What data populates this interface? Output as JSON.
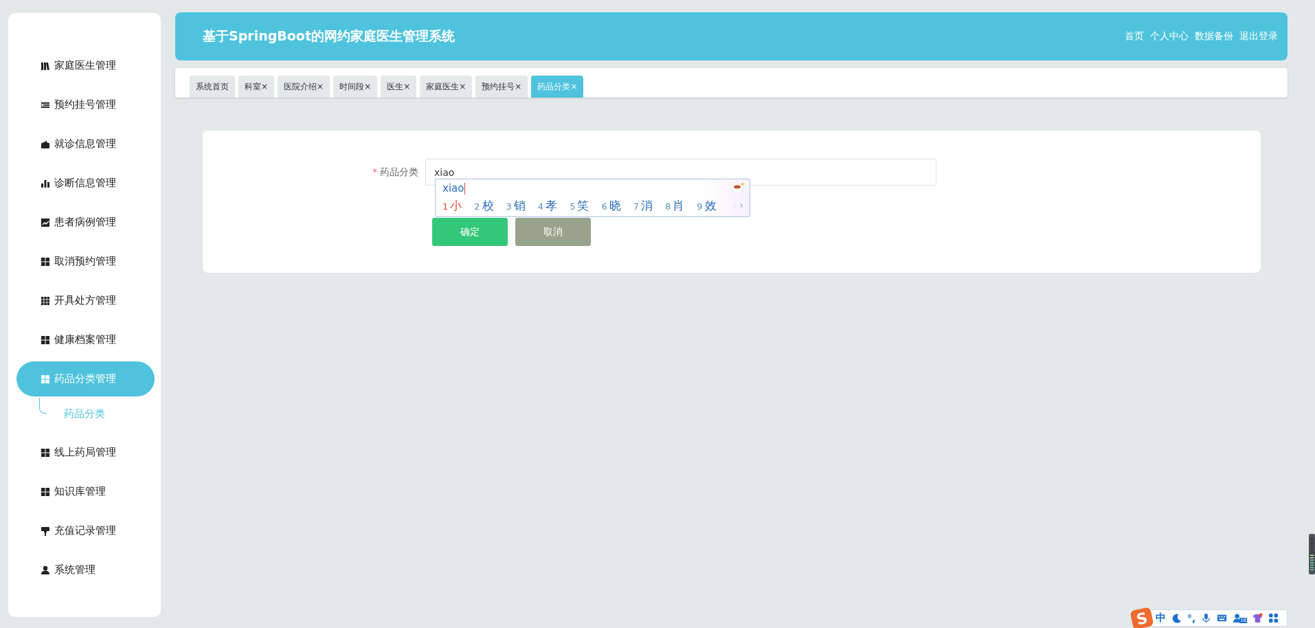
{
  "sidebar": {
    "items": [
      {
        "label": "家庭医生管理",
        "selected": false
      },
      {
        "label": "预约挂号管理",
        "selected": false
      },
      {
        "label": "就诊信息管理",
        "selected": false
      },
      {
        "label": "诊断信息管理",
        "selected": false
      },
      {
        "label": "患者病例管理",
        "selected": false
      },
      {
        "label": "取消预约管理",
        "selected": false
      },
      {
        "label": "开具处方管理",
        "selected": false
      },
      {
        "label": "健康档案管理",
        "selected": false
      },
      {
        "label": "药品分类管理",
        "selected": true,
        "children": [
          {
            "label": "药品分类",
            "selected": true
          }
        ]
      },
      {
        "label": "线上药局管理",
        "selected": false
      },
      {
        "label": "知识库管理",
        "selected": false
      },
      {
        "label": "充值记录管理",
        "selected": false
      },
      {
        "label": "系统管理",
        "selected": false
      }
    ]
  },
  "header": {
    "title": "基于SpringBoot的网约家庭医生管理系统",
    "links": [
      "首页",
      "个人中心",
      "数据备份",
      "退出登录"
    ]
  },
  "tabs": [
    {
      "label": "系统首页",
      "selected": false
    },
    {
      "label": "科室",
      "close": "×",
      "selected": false
    },
    {
      "label": "医院介绍",
      "close": "×",
      "selected": false
    },
    {
      "label": "时间段",
      "close": "×",
      "selected": false
    },
    {
      "label": "医生",
      "close": "×",
      "selected": false
    },
    {
      "label": "家庭医生",
      "close": "×",
      "selected": false
    },
    {
      "label": "预约挂号",
      "close": "×",
      "selected": false
    },
    {
      "label": "药品分类",
      "close": "×",
      "selected": true
    }
  ],
  "form": {
    "fields": [
      {
        "label": "药品分类",
        "required": true,
        "required_mark": "*",
        "value": "xiao"
      }
    ],
    "buttons": [
      {
        "label": "确定",
        "kind": "primary"
      },
      {
        "label": "取消",
        "kind": "cancel"
      }
    ]
  },
  "ime": {
    "composition": "xiao",
    "prev_enabled": false,
    "next_enabled": true,
    "candidates": [
      {
        "index": "1",
        "text": "小",
        "selected": true
      },
      {
        "index": "2",
        "text": "校",
        "selected": false
      },
      {
        "index": "3",
        "text": "销",
        "selected": false
      },
      {
        "index": "4",
        "text": "孝",
        "selected": false
      },
      {
        "index": "5",
        "text": "笑",
        "selected": false
      },
      {
        "index": "6",
        "text": "晓",
        "selected": false
      },
      {
        "index": "7",
        "text": "消",
        "selected": false
      },
      {
        "index": "8",
        "text": "肖",
        "selected": false
      },
      {
        "index": "9",
        "text": "效",
        "selected": false
      }
    ]
  },
  "ime_toolbar": {
    "logo": "S",
    "mode": "中",
    "punctuation": "°,",
    "badge": "16"
  }
}
